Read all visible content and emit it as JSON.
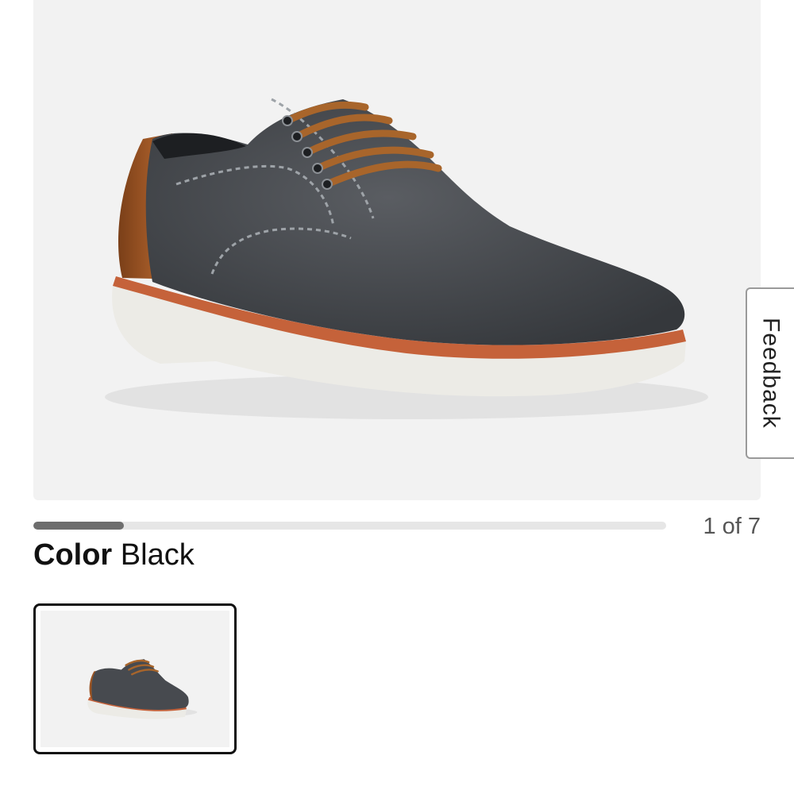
{
  "gallery": {
    "image_alt": "Dark grey canvas lace-up derby shoe with cognac leather heel, brown laces and white sole",
    "position_text": "1 of 7",
    "current_index": 1,
    "total_images": 7,
    "progress_fraction": 0.142857
  },
  "feedback": {
    "label": "Feedback"
  },
  "color_selector": {
    "label": "Color",
    "selected_value": "Black",
    "swatches": [
      {
        "name": "Black",
        "selected": true
      }
    ]
  },
  "colors": {
    "canvas": "#4a4d52",
    "heel_leather": "#9a5424",
    "laces": "#a8652b",
    "sole": "#ecebe6",
    "welt": "#c5623a",
    "background": "#f2f2f2"
  }
}
